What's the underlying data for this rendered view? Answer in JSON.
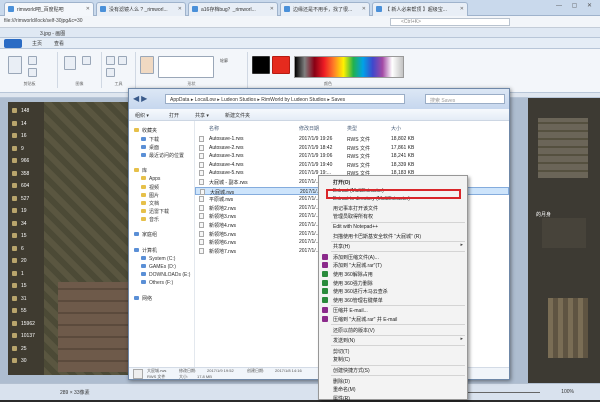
{
  "browser": {
    "tabs": [
      {
        "label": "rimworld吧_百度贴吧"
      },
      {
        "label": "没有滤镜人么 ? _rimworl..."
      },
      {
        "label": "a16存档bug？_rimworl..."
      },
      {
        "label": "边缘还是不用手，找了很..."
      },
      {
        "label": "【 新人必来帮顶 】超级宝..."
      }
    ],
    "url": "file:///rimworld/lock/self-30jpg&c=30",
    "search_placeholder": "<Ctrl+K>"
  },
  "paint": {
    "title": "3.jpg - 画图",
    "tabs": [
      "主页",
      "查看"
    ],
    "ribbon_groups": [
      "剪贴板",
      "图像",
      "工具",
      "形状",
      "颜色"
    ],
    "outline_label": "轮廓",
    "dimensions": "289 × 33像素",
    "zoom": "100%"
  },
  "game": {
    "resources": [
      {
        "value": "148"
      },
      {
        "value": "14"
      },
      {
        "value": "16"
      },
      {
        "value": "9"
      },
      {
        "value": "966"
      },
      {
        "value": "358"
      },
      {
        "value": "604"
      },
      {
        "value": "527"
      },
      {
        "value": "19"
      },
      {
        "value": "34"
      },
      {
        "value": "15"
      },
      {
        "value": "6"
      },
      {
        "value": "20"
      },
      {
        "value": "1"
      },
      {
        "value": "15"
      },
      {
        "value": "31"
      },
      {
        "value": "55"
      },
      {
        "value": "15962"
      },
      {
        "value": "10137"
      },
      {
        "value": "25"
      },
      {
        "value": "30"
      }
    ],
    "right_text": "的月身"
  },
  "explorer": {
    "breadcrumbs": [
      "AppData",
      "LocalLow",
      "Ludeon Studios",
      "RimWorld by Ludeon Studios",
      "Saves"
    ],
    "search_placeholder": "搜索 Saves",
    "toolbar": [
      "组织 ▾",
      "打开",
      "共享 ▾",
      "新建文件夹"
    ],
    "nav": {
      "favorites": {
        "header": "收藏夹",
        "items": [
          "下载",
          "桌面",
          "最近访问的位置"
        ]
      },
      "libraries": {
        "header": "库",
        "items": [
          "Apps",
          "视频",
          "图片",
          "文档",
          "迅雷下载",
          "音乐"
        ]
      },
      "homegroup": "家庭组",
      "computer": {
        "header": "计算机",
        "items": [
          "System (C:)",
          "GAMEs (D:)",
          "DOWNLOADs (E:)",
          "Others (F:)"
        ]
      },
      "network": "网络"
    },
    "columns": [
      "名称",
      "修改日期",
      "类型",
      "大小"
    ],
    "files": [
      {
        "name": "Autosave-1.rws",
        "date": "2017/1/9 19:26",
        "type": "RWS 文件",
        "size": "18,802 KB"
      },
      {
        "name": "Autosave-2.rws",
        "date": "2017/1/9 18:42",
        "type": "RWS 文件",
        "size": "17,861 KB"
      },
      {
        "name": "Autosave-3.rws",
        "date": "2017/1/9 19:06",
        "type": "RWS 文件",
        "size": "18,241 KB"
      },
      {
        "name": "Autosave-4.rws",
        "date": "2017/1/9 19:40",
        "type": "RWS 文件",
        "size": "18,339 KB"
      },
      {
        "name": "Autosave-5.rws",
        "date": "2017/1/9 19:...",
        "type": "RWS 文件",
        "size": "18,183 KB"
      },
      {
        "name": "大屁城 - 副本.rws",
        "date": "2017/1/...",
        "type": "",
        "size": ""
      },
      {
        "name": "大屁城.rws",
        "date": "2017/1/...",
        "type": "",
        "size": ""
      },
      {
        "name": "平原城.rws",
        "date": "2017/1/...",
        "type": "",
        "size": ""
      },
      {
        "name": "新领地2.rws",
        "date": "2017/1/...",
        "type": "",
        "size": ""
      },
      {
        "name": "新领地3.rws",
        "date": "2017/1/...",
        "type": "",
        "size": ""
      },
      {
        "name": "新领地4.rws",
        "date": "2017/1/...",
        "type": "",
        "size": ""
      },
      {
        "name": "新领地5.rws",
        "date": "2017/1/...",
        "type": "",
        "size": ""
      },
      {
        "name": "新领地6.rws",
        "date": "2017/1/...",
        "type": "",
        "size": ""
      },
      {
        "name": "新领地7.rws",
        "date": "2017/1/...",
        "type": "",
        "size": ""
      }
    ],
    "details": {
      "name": "大屁城.rws",
      "type": "RWS 文件",
      "modified_label": "修改日期:",
      "modified": "2017/1/9 19:52",
      "size_label": "大小:",
      "size": "17.8 MB",
      "created_label": "创建日期:",
      "created": "2017/1/8 14:16"
    }
  },
  "context_menu": {
    "items": [
      {
        "label": "打开(O)",
        "bold": true
      },
      {
        "label": "Extract (MultiExtractor)"
      },
      {
        "label": "Extract to directory (MultiExtractor)"
      },
      {
        "label": "用记事本打开该文件"
      },
      {
        "label": "管理员取得所有权"
      },
      {
        "label": "Edit with Notepad++"
      },
      {
        "label": "扫描使用卡巴斯基安全软件 “大屁城” (R)"
      },
      {
        "label": "共享(H)",
        "submenu": true
      },
      {
        "label": "添加到压缩文件(A)..."
      },
      {
        "label": "添加到 \"大屁城.rar\"(T)"
      },
      {
        "label": "使用 360解除占用"
      },
      {
        "label": "使用 360强力删除"
      },
      {
        "label": "使用 360进行木马云查杀"
      },
      {
        "label": "使用 360管理右键菜单"
      },
      {
        "label": "压缩并 E-mail..."
      },
      {
        "label": "压缩到 \"大屁城.rar\" 并 E-mail"
      },
      {
        "label": "还原以前的版本(V)"
      },
      {
        "label": "发送到(N)",
        "submenu": true
      },
      {
        "label": "剪切(T)"
      },
      {
        "label": "复制(C)"
      },
      {
        "label": "创建快捷方式(S)"
      },
      {
        "label": "删除(D)"
      },
      {
        "label": "重命名(M)"
      },
      {
        "label": "属性(R)"
      }
    ],
    "highlight_color": "#d9262a"
  }
}
